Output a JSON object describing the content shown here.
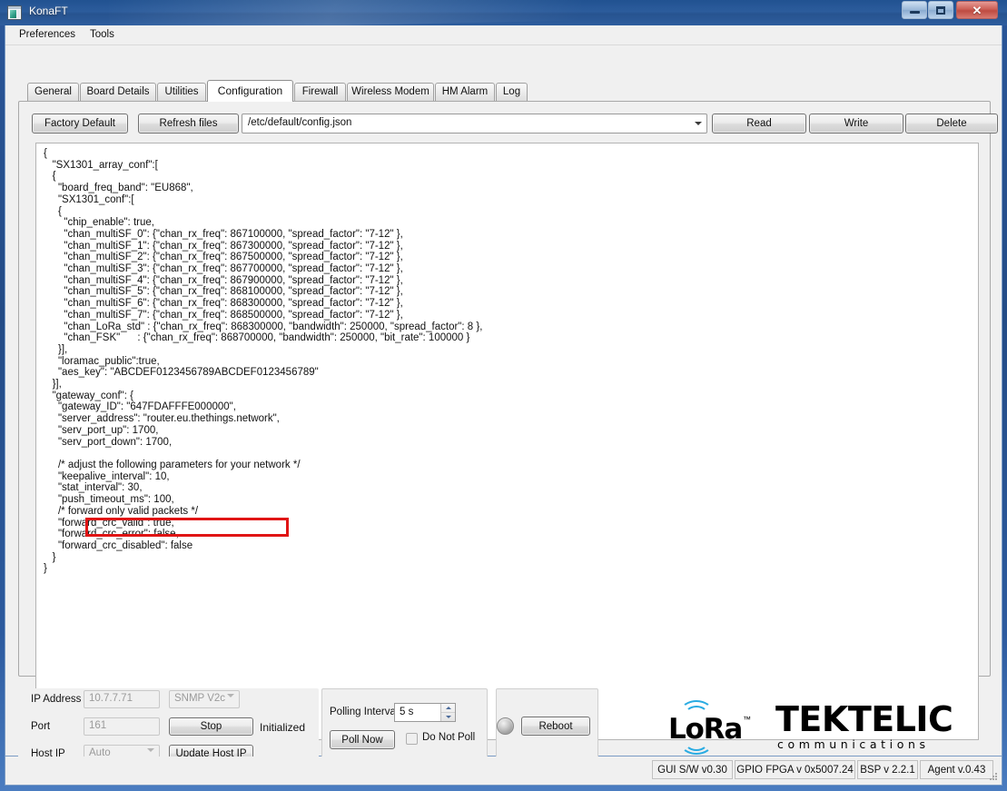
{
  "window": {
    "title": "KonaFT",
    "icon": "form-window-icon",
    "buttons": {
      "minimize": "minimize-button",
      "maximize": "maximize-button",
      "close_label": "✕"
    }
  },
  "menubar": {
    "items": [
      {
        "label": "Preferences"
      },
      {
        "label": "Tools"
      }
    ]
  },
  "tabs": [
    {
      "label": "General",
      "active": false
    },
    {
      "label": "Board Details",
      "active": false
    },
    {
      "label": "Utilities",
      "active": false
    },
    {
      "label": "Configuration",
      "active": true
    },
    {
      "label": "Firewall",
      "active": false
    },
    {
      "label": "Wireless Modem",
      "active": false
    },
    {
      "label": "HM Alarm",
      "active": false
    },
    {
      "label": "Log",
      "active": false
    }
  ],
  "toolbar": {
    "factory_default_label": "Factory Default",
    "refresh_files_label": "Refresh files",
    "file_combo_value": "/etc/default/config.json",
    "file_combo_icon": "chevron-down-icon",
    "read_label": "Read",
    "write_label": "Write",
    "delete_label": "Delete"
  },
  "editor": {
    "highlighted_line": "\"gateway_ID\": \"647FDAFFFE000000\",",
    "highlight_color": "#e01515",
    "content": "{\n   \"SX1301_array_conf\":[\n   {\n     \"board_freq_band\": \"EU868\",\n     \"SX1301_conf\":[\n     {\n       \"chip_enable\": true,\n       \"chan_multiSF_0\": {\"chan_rx_freq\": 867100000, \"spread_factor\": \"7-12\" },\n       \"chan_multiSF_1\": {\"chan_rx_freq\": 867300000, \"spread_factor\": \"7-12\" },\n       \"chan_multiSF_2\": {\"chan_rx_freq\": 867500000, \"spread_factor\": \"7-12\" },\n       \"chan_multiSF_3\": {\"chan_rx_freq\": 867700000, \"spread_factor\": \"7-12\" },\n       \"chan_multiSF_4\": {\"chan_rx_freq\": 867900000, \"spread_factor\": \"7-12\" },\n       \"chan_multiSF_5\": {\"chan_rx_freq\": 868100000, \"spread_factor\": \"7-12\" },\n       \"chan_multiSF_6\": {\"chan_rx_freq\": 868300000, \"spread_factor\": \"7-12\" },\n       \"chan_multiSF_7\": {\"chan_rx_freq\": 868500000, \"spread_factor\": \"7-12\" },\n       \"chan_LoRa_std\" : {\"chan_rx_freq\": 868300000, \"bandwidth\": 250000, \"spread_factor\": 8 },\n       \"chan_FSK\"      : {\"chan_rx_freq\": 868700000, \"bandwidth\": 250000, \"bit_rate\": 100000 }\n     }],\n     \"loramac_public\":true,\n     \"aes_key\": \"ABCDEF0123456789ABCDEF0123456789\"\n   }],\n   \"gateway_conf\": {\n     \"gateway_ID\": \"647FDAFFFE000000\",\n     \"server_address\": \"router.eu.thethings.network\",\n     \"serv_port_up\": 1700,\n     \"serv_port_down\": 1700,\n\n     /* adjust the following parameters for your network */\n     \"keepalive_interval\": 10,\n     \"stat_interval\": 30,\n     \"push_timeout_ms\": 100,\n     /* forward only valid packets */\n     \"forward_crc_valid\": true,\n     \"forward_crc_error\": false,\n     \"forward_crc_disabled\": false\n   }\n}"
  },
  "connection": {
    "ip_address_label": "IP Address",
    "ip_address_value": "10.7.7.71",
    "protocol_value": "SNMP V2c",
    "protocol_icon": "chevron-down-icon",
    "port_label": "Port",
    "port_value": "161",
    "stop_label": "Stop",
    "status_text": "Initialized",
    "host_ip_label": "Host IP",
    "host_ip_value": "Auto",
    "host_ip_icon": "chevron-down-icon",
    "update_host_ip_label": "Update Host IP"
  },
  "polling": {
    "interval_label": "Polling Interval:",
    "interval_value": "5 s",
    "spinner_up_icon": "caret-up-icon",
    "spinner_down_icon": "caret-down-icon",
    "poll_now_label": "Poll Now",
    "do_not_poll_label": "Do Not Poll",
    "do_not_poll_checked": false
  },
  "reboot": {
    "led_icon": "led-indicator-off",
    "reboot_label": "Reboot"
  },
  "branding": {
    "lora_word": "LoRa",
    "lora_tm": "™",
    "lora_accent": "#29abe2",
    "tektelic_word": "TEKTELIC",
    "tektelic_sub": "communications"
  },
  "statusbar": {
    "cells": [
      {
        "label": "GUI S/W v0.30"
      },
      {
        "label": "GPIO FPGA v 0x5007.24"
      },
      {
        "label": "BSP v 2.2.1"
      },
      {
        "label": "Agent v.0.43"
      }
    ]
  }
}
